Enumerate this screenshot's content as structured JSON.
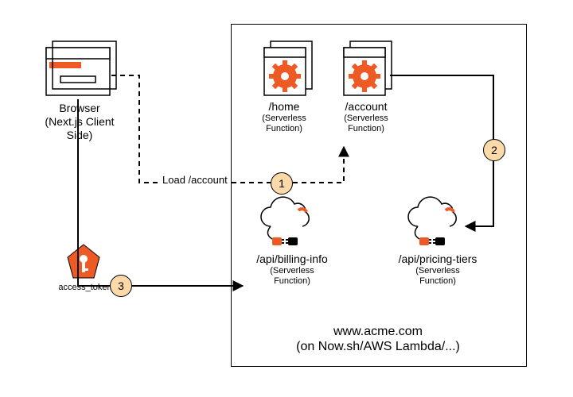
{
  "diagram": {
    "browser": {
      "title": "Browser",
      "subtitle1": "(Next.js Client",
      "subtitle2": "Side)"
    },
    "server_box_title_line1": "www.acme.com",
    "server_box_title_line2": "(on Now.sh/AWS Lambda/...)",
    "nodes": {
      "home": {
        "path": "/home",
        "sub1": "(Serverless",
        "sub2": "Function)"
      },
      "account": {
        "path": "/account",
        "sub1": "(Serverless",
        "sub2": "Function)"
      },
      "billing": {
        "path": "/api/billing-info",
        "sub1": "(Serverless",
        "sub2": "Function)"
      },
      "pricing": {
        "path": "/api/pricing-tiers",
        "sub1": "(Serverless",
        "sub2": "Function)"
      }
    },
    "token_label": "access_token",
    "edge_load_label": "Load /account",
    "steps": {
      "one": "1",
      "two": "2",
      "three": "3"
    },
    "colors": {
      "accent": "#ee5a24",
      "badge": "#fcd9a8"
    }
  }
}
